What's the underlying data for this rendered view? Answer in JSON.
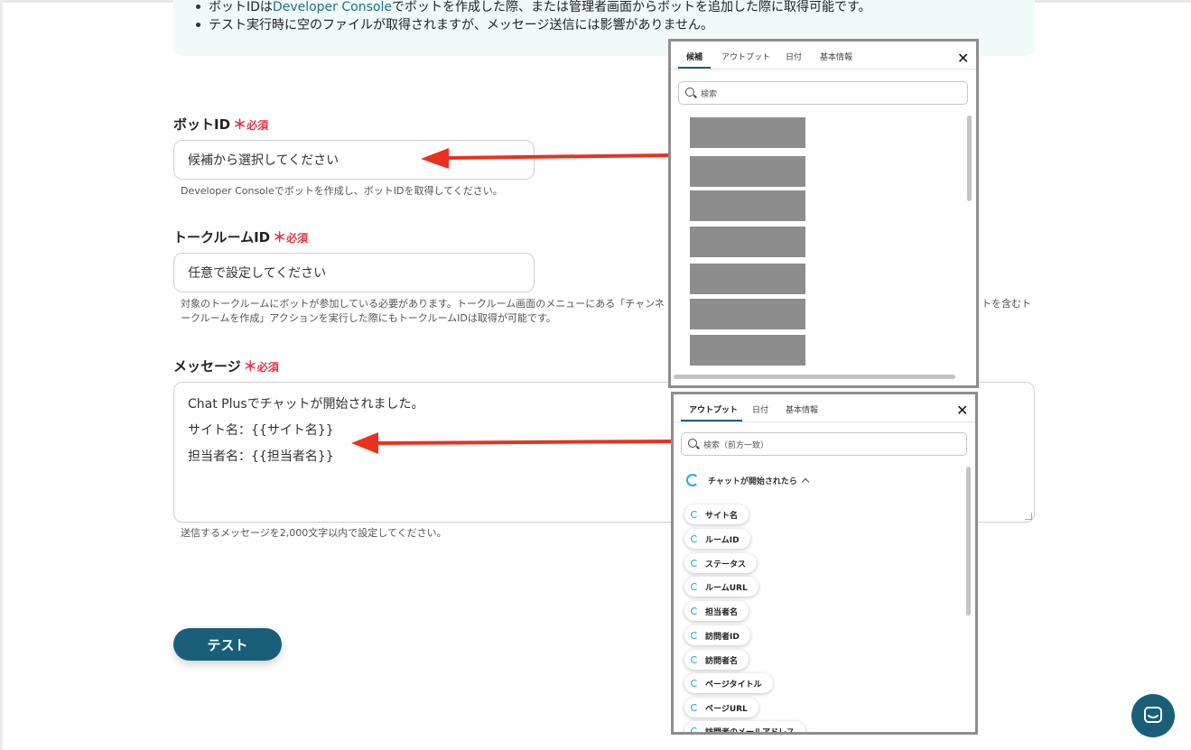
{
  "notice": {
    "line1_prefix": "ボットIDは",
    "line1_link": "Developer Console",
    "line1_suffix": "でボットを作成した際、または管理者画面からボットを追加した際に取得可能です。",
    "line2": "テスト実行時に空のファイルが取得されますが、メッセージ送信には影響がありません。"
  },
  "fields": {
    "bot_id": {
      "label": "ボットID",
      "required_mark": "＊",
      "required_text": "必須",
      "placeholder": "候補から選択してください",
      "help": "Developer Consoleでボットを作成し、ボットIDを取得してください。"
    },
    "room_id": {
      "label": "トークルームID",
      "required_mark": "＊",
      "required_text": "必須",
      "placeholder": "任意で設定してください",
      "help_line1_left": "対象のトークルームにボットが参加している必要があります。トークルーム画面のメニューにある「チャンネ",
      "help_line1_right": "トを含むト",
      "help_line2": "ークルームを作成」アクションを実行した際にもトークルームIDは取得が可能です。"
    },
    "message": {
      "label": "メッセージ",
      "required_mark": "＊",
      "required_text": "必須",
      "lines": [
        "Chat Plusでチャットが開始されました。",
        "サイト名：{{サイト名}}",
        "担当者名：{{担当者名}}"
      ],
      "help": "送信するメッセージを2,000文字以内で設定してください。"
    }
  },
  "test_button": "テスト",
  "candidates_popup": {
    "tabs": [
      "候補",
      "アウトプット",
      "日付",
      "基本情報"
    ],
    "active_tab": "候補",
    "close": "✕",
    "search_placeholder": "検索",
    "redacted_item_count": 7
  },
  "output_popup": {
    "tabs": [
      "アウトプット",
      "日付",
      "基本情報"
    ],
    "active_tab": "アウトプット",
    "close": "✕",
    "search_placeholder": "検索（前方一致）",
    "group_title": "チャットが開始されたら",
    "items": [
      "サイト名",
      "ルームID",
      "ステータス",
      "ルームURL",
      "担当者名",
      "訪問者ID",
      "訪問者名",
      "ページタイトル",
      "ページURL"
    ],
    "cut_item": "訪問者のメールアドレス"
  },
  "colors": {
    "accent": "#1a5f7a",
    "required": "#e2364a",
    "arrow": "#e8321f",
    "notice_bg": "#f1f9f9"
  },
  "icons": {
    "chat_launcher": "chat-bubble-icon",
    "search": "search-icon",
    "close": "close-icon"
  }
}
